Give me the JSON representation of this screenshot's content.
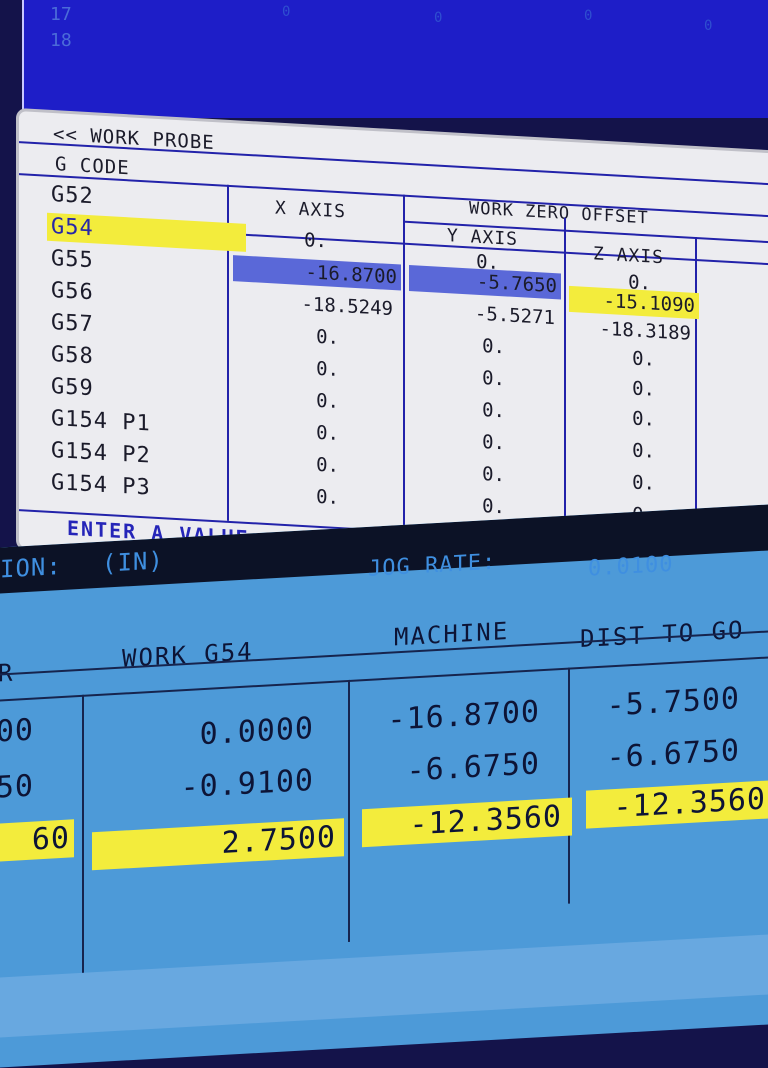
{
  "program_panel": {
    "line_numbers": [
      "17",
      "18"
    ]
  },
  "offsets": {
    "tab_label": "<< WORK PROBE",
    "gcode_header": "G CODE",
    "group_header": "WORK ZERO OFFSET",
    "axis_headers": [
      "X AXIS",
      "Y AXIS",
      "Z AXIS"
    ],
    "rows": [
      {
        "g": "G52",
        "x": "",
        "y": "",
        "z": ""
      },
      {
        "g": "G54",
        "x": "0.",
        "y": "0.",
        "z": "0.",
        "selected": true
      },
      {
        "g": "G55",
        "x": "-16.8700",
        "y": "-5.7650",
        "z": "-15.1090"
      },
      {
        "g": "G56",
        "x": "-18.5249",
        "y": "-5.5271",
        "z": "-18.3189"
      },
      {
        "g": "G57",
        "x": "0.",
        "y": "0.",
        "z": "0."
      },
      {
        "g": "G58",
        "x": "0.",
        "y": "0.",
        "z": "0."
      },
      {
        "g": "G59",
        "x": "0.",
        "y": "0.",
        "z": "0."
      },
      {
        "g": "G154 P1",
        "x": "0.",
        "y": "0.",
        "z": "0."
      },
      {
        "g": "G154 P2",
        "x": "0.",
        "y": "0.",
        "z": "0."
      },
      {
        "g": "G154 P3",
        "x": "0.",
        "y": "0.",
        "z": "0."
      }
    ],
    "prompt": "ENTER A VALUE"
  },
  "positions": {
    "units_label": "ION:",
    "units_value": "(IN)",
    "jog_rate_label": "JOG RATE:",
    "jog_rate_value": "0.0100",
    "columns": [
      "R",
      "WORK   G54",
      "MACHINE",
      "DIST TO GO"
    ],
    "partial_col": [
      "00",
      "50",
      "60"
    ],
    "work": [
      "0.0000",
      "-0.9100",
      "2.7500"
    ],
    "machine": [
      "-16.8700",
      "-6.6750",
      "-12.3560"
    ],
    "dist_to_go": [
      "-5.7500",
      "-6.6750",
      "-12.3560"
    ]
  },
  "colors": {
    "highlight_yellow": "#f3ec3c",
    "highlight_blue": "#5a68d8",
    "panel_blue": "#4d9ad8",
    "program_blue": "#1e1ec8"
  }
}
